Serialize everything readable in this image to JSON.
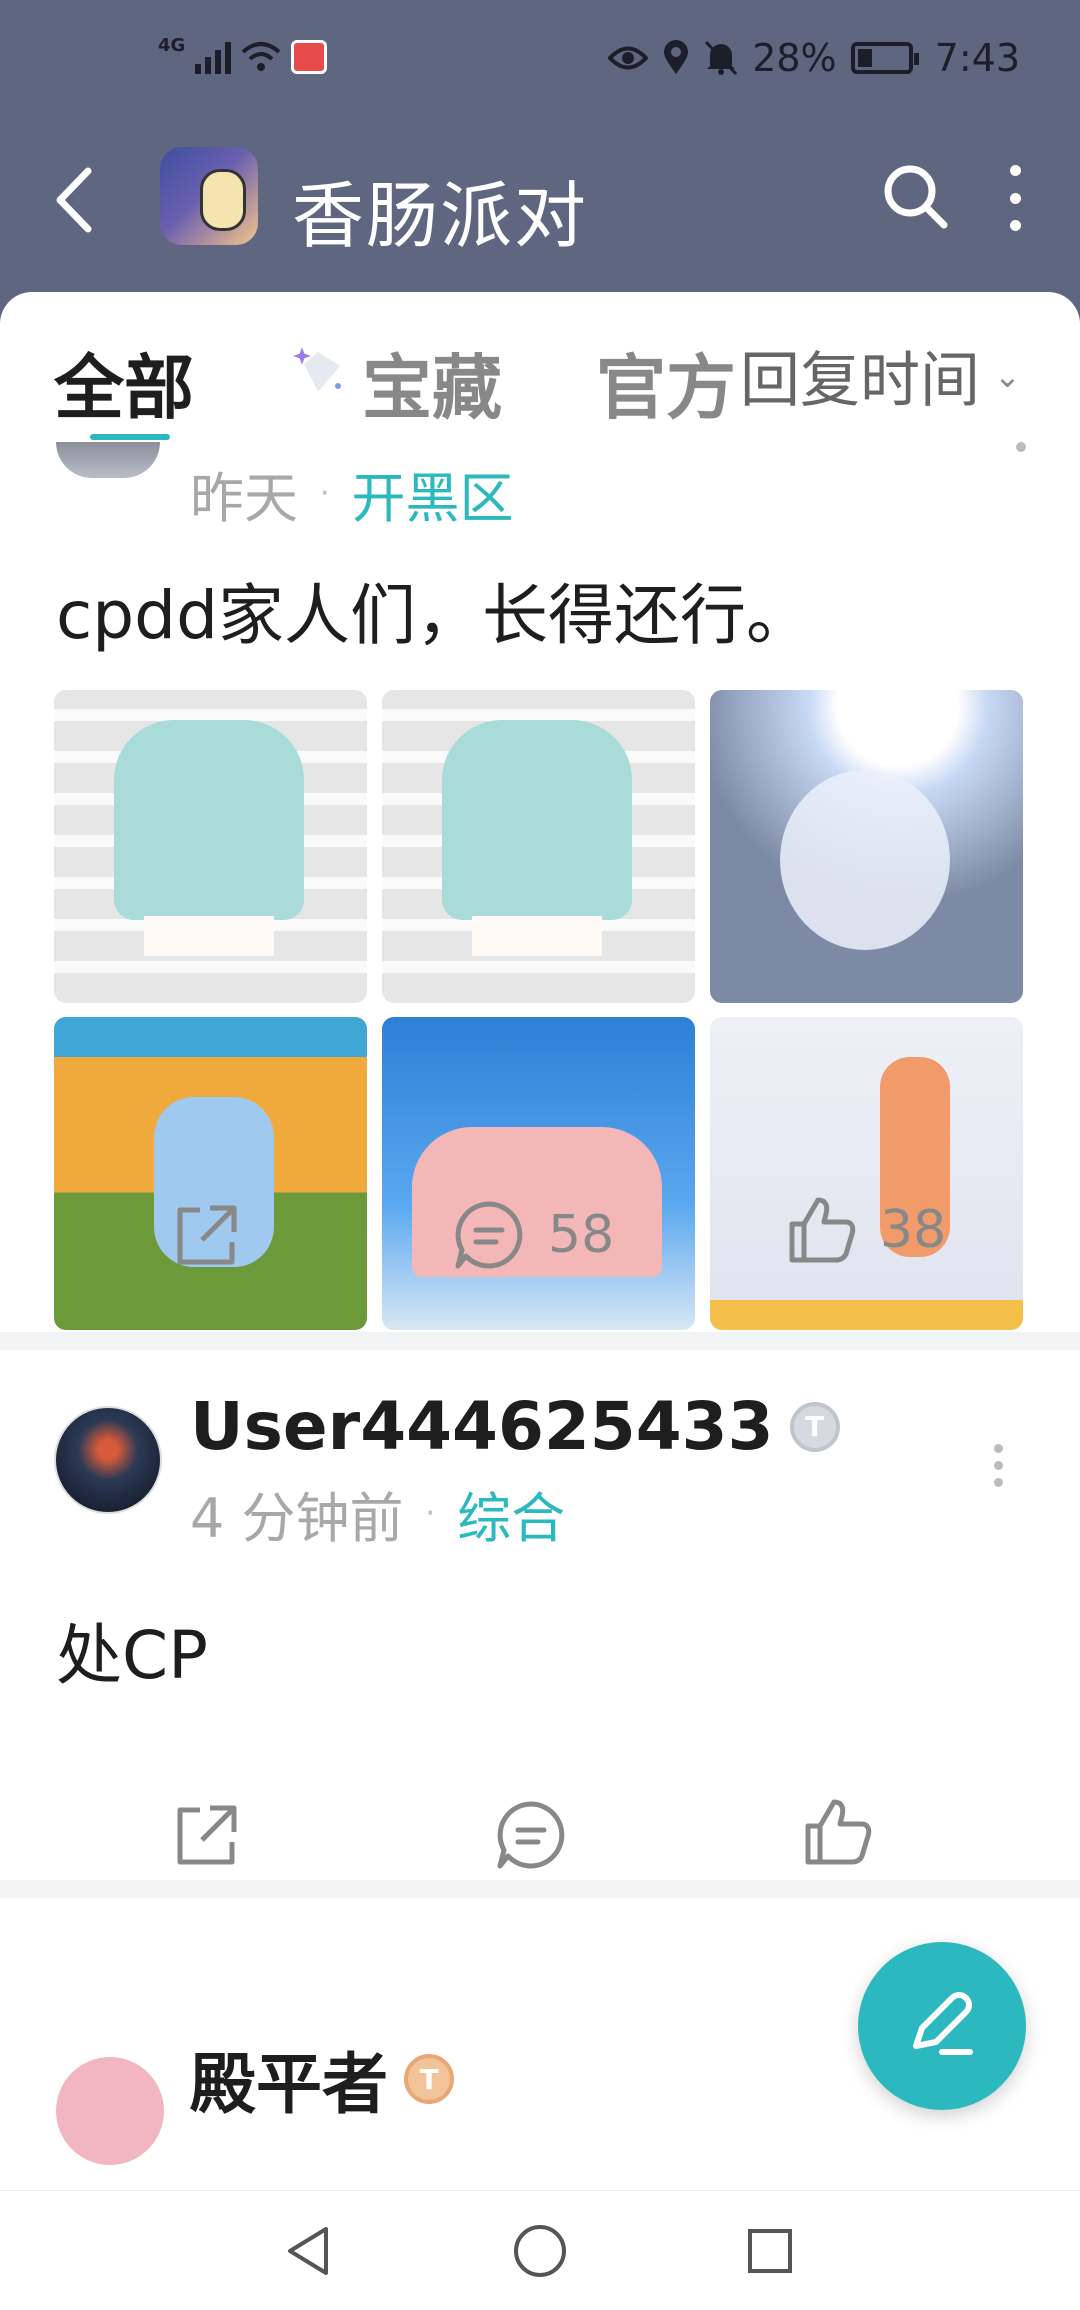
{
  "status_bar": {
    "network": "4G",
    "battery_percent": "28%",
    "time": "7:43"
  },
  "header": {
    "title": "香肠派对",
    "back_icon": "chevron-left-icon",
    "search_icon": "search-icon",
    "more_icon": "more-vertical-icon"
  },
  "tabs": {
    "items": [
      {
        "label": "全部",
        "active": true
      },
      {
        "label": "宝藏",
        "active": false
      },
      {
        "label": "官方",
        "active": false
      }
    ],
    "sort_label": "回复时间"
  },
  "posts": [
    {
      "time": "昨天",
      "category": "开黑区",
      "body": "cpdd家人们，长得还行。",
      "images": [
        "photo",
        "photo",
        "photo",
        "game screenshot",
        "game screenshot",
        "game screenshot"
      ],
      "comments": "58",
      "likes": "38"
    },
    {
      "username": "User444625433",
      "level_badge": "T",
      "time": "4 分钟前",
      "category": "综合",
      "body": "处CP"
    },
    {
      "username": "殿平者",
      "level_badge": "T"
    }
  ],
  "colors": {
    "accent": "#2bb9bf",
    "header_bg": "#5f6680"
  }
}
